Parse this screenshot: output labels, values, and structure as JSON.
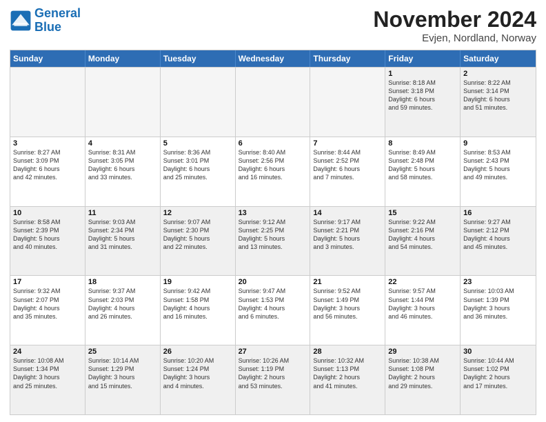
{
  "logo": {
    "line1": "General",
    "line2": "Blue"
  },
  "title": "November 2024",
  "subtitle": "Evjen, Nordland, Norway",
  "headers": [
    "Sunday",
    "Monday",
    "Tuesday",
    "Wednesday",
    "Thursday",
    "Friday",
    "Saturday"
  ],
  "weeks": [
    [
      {
        "day": "",
        "info": ""
      },
      {
        "day": "",
        "info": ""
      },
      {
        "day": "",
        "info": ""
      },
      {
        "day": "",
        "info": ""
      },
      {
        "day": "",
        "info": ""
      },
      {
        "day": "1",
        "info": "Sunrise: 8:18 AM\nSunset: 3:18 PM\nDaylight: 6 hours\nand 59 minutes."
      },
      {
        "day": "2",
        "info": "Sunrise: 8:22 AM\nSunset: 3:14 PM\nDaylight: 6 hours\nand 51 minutes."
      }
    ],
    [
      {
        "day": "3",
        "info": "Sunrise: 8:27 AM\nSunset: 3:09 PM\nDaylight: 6 hours\nand 42 minutes."
      },
      {
        "day": "4",
        "info": "Sunrise: 8:31 AM\nSunset: 3:05 PM\nDaylight: 6 hours\nand 33 minutes."
      },
      {
        "day": "5",
        "info": "Sunrise: 8:36 AM\nSunset: 3:01 PM\nDaylight: 6 hours\nand 25 minutes."
      },
      {
        "day": "6",
        "info": "Sunrise: 8:40 AM\nSunset: 2:56 PM\nDaylight: 6 hours\nand 16 minutes."
      },
      {
        "day": "7",
        "info": "Sunrise: 8:44 AM\nSunset: 2:52 PM\nDaylight: 6 hours\nand 7 minutes."
      },
      {
        "day": "8",
        "info": "Sunrise: 8:49 AM\nSunset: 2:48 PM\nDaylight: 5 hours\nand 58 minutes."
      },
      {
        "day": "9",
        "info": "Sunrise: 8:53 AM\nSunset: 2:43 PM\nDaylight: 5 hours\nand 49 minutes."
      }
    ],
    [
      {
        "day": "10",
        "info": "Sunrise: 8:58 AM\nSunset: 2:39 PM\nDaylight: 5 hours\nand 40 minutes."
      },
      {
        "day": "11",
        "info": "Sunrise: 9:03 AM\nSunset: 2:34 PM\nDaylight: 5 hours\nand 31 minutes."
      },
      {
        "day": "12",
        "info": "Sunrise: 9:07 AM\nSunset: 2:30 PM\nDaylight: 5 hours\nand 22 minutes."
      },
      {
        "day": "13",
        "info": "Sunrise: 9:12 AM\nSunset: 2:25 PM\nDaylight: 5 hours\nand 13 minutes."
      },
      {
        "day": "14",
        "info": "Sunrise: 9:17 AM\nSunset: 2:21 PM\nDaylight: 5 hours\nand 3 minutes."
      },
      {
        "day": "15",
        "info": "Sunrise: 9:22 AM\nSunset: 2:16 PM\nDaylight: 4 hours\nand 54 minutes."
      },
      {
        "day": "16",
        "info": "Sunrise: 9:27 AM\nSunset: 2:12 PM\nDaylight: 4 hours\nand 45 minutes."
      }
    ],
    [
      {
        "day": "17",
        "info": "Sunrise: 9:32 AM\nSunset: 2:07 PM\nDaylight: 4 hours\nand 35 minutes."
      },
      {
        "day": "18",
        "info": "Sunrise: 9:37 AM\nSunset: 2:03 PM\nDaylight: 4 hours\nand 26 minutes."
      },
      {
        "day": "19",
        "info": "Sunrise: 9:42 AM\nSunset: 1:58 PM\nDaylight: 4 hours\nand 16 minutes."
      },
      {
        "day": "20",
        "info": "Sunrise: 9:47 AM\nSunset: 1:53 PM\nDaylight: 4 hours\nand 6 minutes."
      },
      {
        "day": "21",
        "info": "Sunrise: 9:52 AM\nSunset: 1:49 PM\nDaylight: 3 hours\nand 56 minutes."
      },
      {
        "day": "22",
        "info": "Sunrise: 9:57 AM\nSunset: 1:44 PM\nDaylight: 3 hours\nand 46 minutes."
      },
      {
        "day": "23",
        "info": "Sunrise: 10:03 AM\nSunset: 1:39 PM\nDaylight: 3 hours\nand 36 minutes."
      }
    ],
    [
      {
        "day": "24",
        "info": "Sunrise: 10:08 AM\nSunset: 1:34 PM\nDaylight: 3 hours\nand 25 minutes."
      },
      {
        "day": "25",
        "info": "Sunrise: 10:14 AM\nSunset: 1:29 PM\nDaylight: 3 hours\nand 15 minutes."
      },
      {
        "day": "26",
        "info": "Sunrise: 10:20 AM\nSunset: 1:24 PM\nDaylight: 3 hours\nand 4 minutes."
      },
      {
        "day": "27",
        "info": "Sunrise: 10:26 AM\nSunset: 1:19 PM\nDaylight: 2 hours\nand 53 minutes."
      },
      {
        "day": "28",
        "info": "Sunrise: 10:32 AM\nSunset: 1:13 PM\nDaylight: 2 hours\nand 41 minutes."
      },
      {
        "day": "29",
        "info": "Sunrise: 10:38 AM\nSunset: 1:08 PM\nDaylight: 2 hours\nand 29 minutes."
      },
      {
        "day": "30",
        "info": "Sunrise: 10:44 AM\nSunset: 1:02 PM\nDaylight: 2 hours\nand 17 minutes."
      }
    ]
  ]
}
